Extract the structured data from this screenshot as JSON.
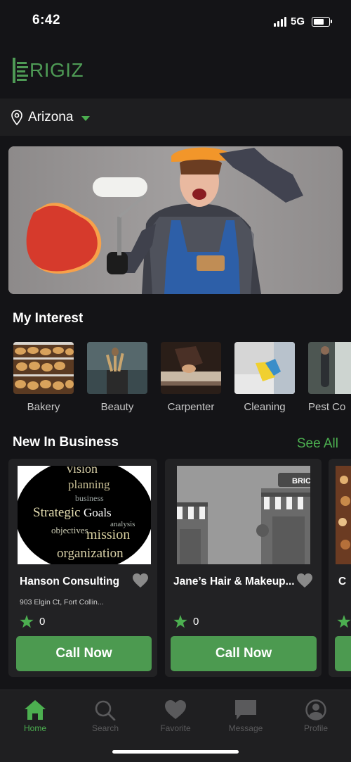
{
  "status_bar": {
    "time": "6:42",
    "network": "5G"
  },
  "app": {
    "logo_text": "RIGIZ",
    "brand_color": "#4e9a55"
  },
  "location": {
    "name": "Arizona"
  },
  "banner": {
    "name": "promo-banner"
  },
  "interests": {
    "title": "My Interest",
    "items": [
      {
        "label": "Bakery"
      },
      {
        "label": "Beauty"
      },
      {
        "label": "Carpenter"
      },
      {
        "label": "Cleaning"
      },
      {
        "label": "Pest Co"
      }
    ]
  },
  "new_business": {
    "title": "New In Business",
    "see_all": "See All",
    "cards": [
      {
        "name": "Hanson Consulting",
        "address": "903 Elgin Ct, Fort Collin...",
        "rating": "0",
        "call_label": "Call Now",
        "image_words": [
          "vision",
          "planning",
          "business",
          "Strategic",
          "Goals",
          "analysis",
          "objectives",
          "mission",
          "organization"
        ]
      },
      {
        "name": "Jane’s Hair & Makeup...",
        "rating": "0",
        "call_label": "Call Now",
        "image_sign": "BRIC"
      },
      {
        "name": "C"
      }
    ]
  },
  "bottom_nav": {
    "items": [
      {
        "label": "Home",
        "icon": "home-icon",
        "active": true
      },
      {
        "label": "Search",
        "icon": "search-icon"
      },
      {
        "label": "Favorite",
        "icon": "heart-icon"
      },
      {
        "label": "Message",
        "icon": "message-icon"
      },
      {
        "label": "Profile",
        "icon": "profile-icon"
      }
    ]
  },
  "colors": {
    "background": "#141417",
    "accent": "#4caf50",
    "button": "#4c9a50",
    "card": "#222224"
  }
}
